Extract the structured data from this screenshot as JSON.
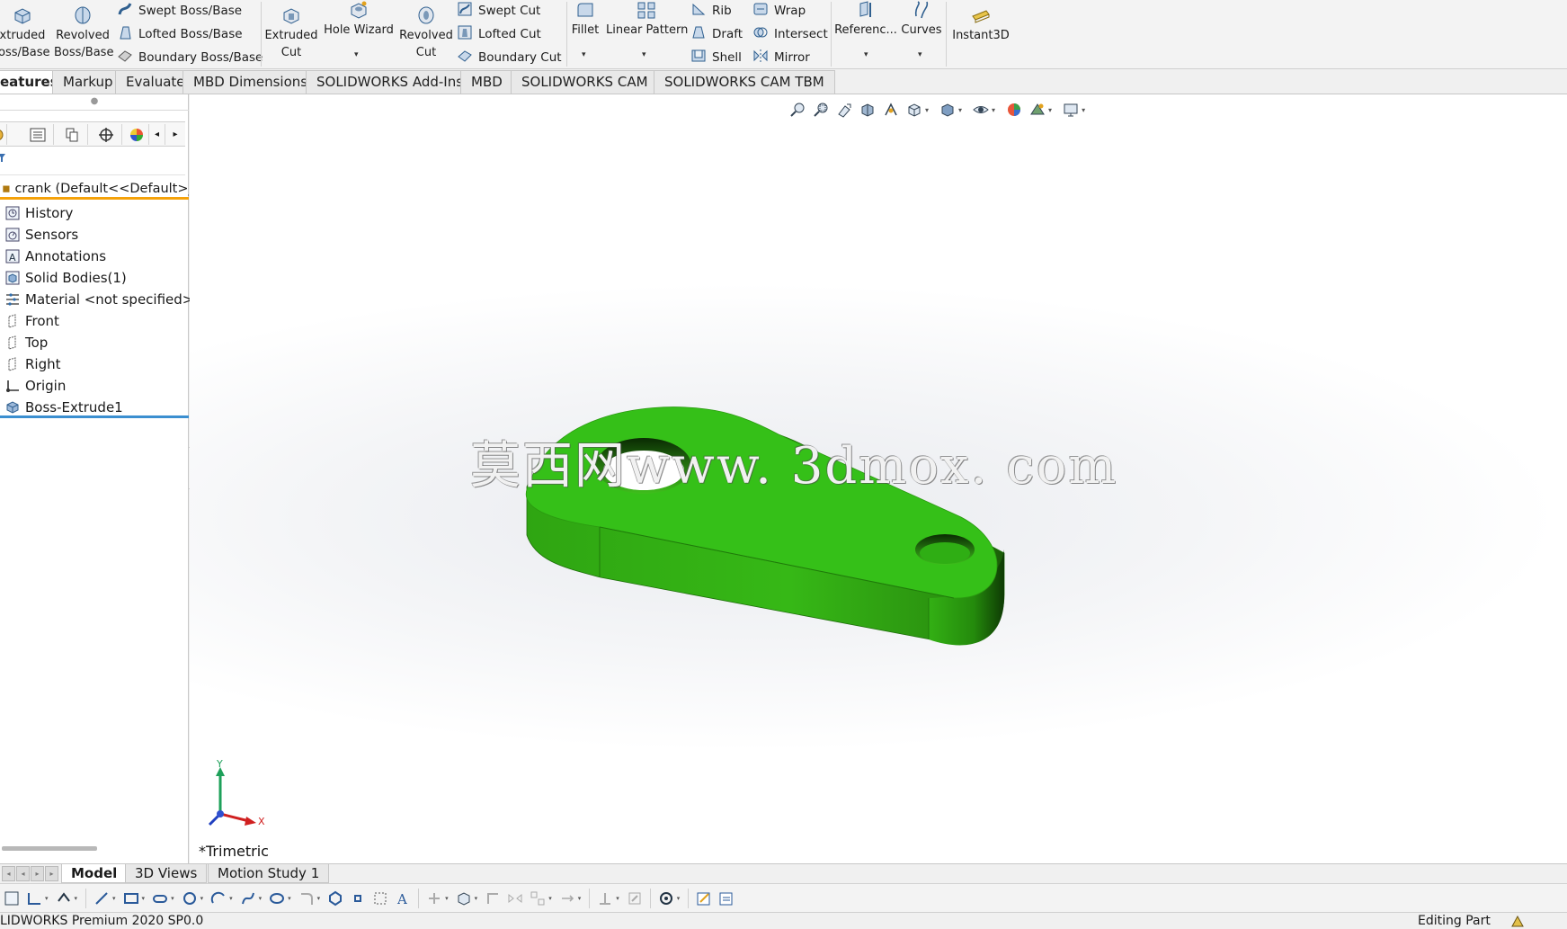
{
  "ribbon": {
    "extruded_boss": [
      "xtruded",
      "oss/Base"
    ],
    "revolved_boss": [
      "Revolved",
      "Boss/Base"
    ],
    "swept_boss": "Swept Boss/Base",
    "lofted_boss": "Lofted Boss/Base",
    "boundary_boss": "Boundary Boss/Base",
    "extruded_cut": [
      "Extruded",
      "Cut"
    ],
    "hole_wizard": "Hole Wizard",
    "revolved_cut": [
      "Revolved",
      "Cut"
    ],
    "swept_cut": "Swept Cut",
    "lofted_cut": "Lofted Cut",
    "boundary_cut": "Boundary Cut",
    "fillet": "Fillet",
    "linear_pattern": "Linear Pattern",
    "rib": "Rib",
    "draft": "Draft",
    "shell": "Shell",
    "wrap": "Wrap",
    "intersect": "Intersect",
    "mirror": "Mirror",
    "reference": "Referenc...",
    "curves": "Curves",
    "instant3d": "Instant3D"
  },
  "tabs": [
    "eatures",
    "Markup",
    "Evaluate",
    "MBD Dimensions",
    "SOLIDWORKS Add-Ins",
    "MBD",
    "SOLIDWORKS CAM",
    "SOLIDWORKS CAM TBM"
  ],
  "feature_manager": {
    "root": "crank  (Default<<Default>_Pho",
    "items": [
      "History",
      "Sensors",
      "Annotations",
      "Solid Bodies(1)",
      "Material <not specified>",
      "Front",
      "Top",
      "Right",
      "Origin",
      "Boss-Extrude1"
    ]
  },
  "viewport": {
    "watermark": "莫西网www. 3dmox. com",
    "view_name": "*Trimetric",
    "triad": {
      "y": "Y",
      "x": "X"
    },
    "part_color": "#35c018"
  },
  "bottom_tabs": [
    "Model",
    "3D Views",
    "Motion Study 1"
  ],
  "status": {
    "left": "LIDWORKS Premium 2020 SP0.0",
    "right": "Editing Part"
  }
}
